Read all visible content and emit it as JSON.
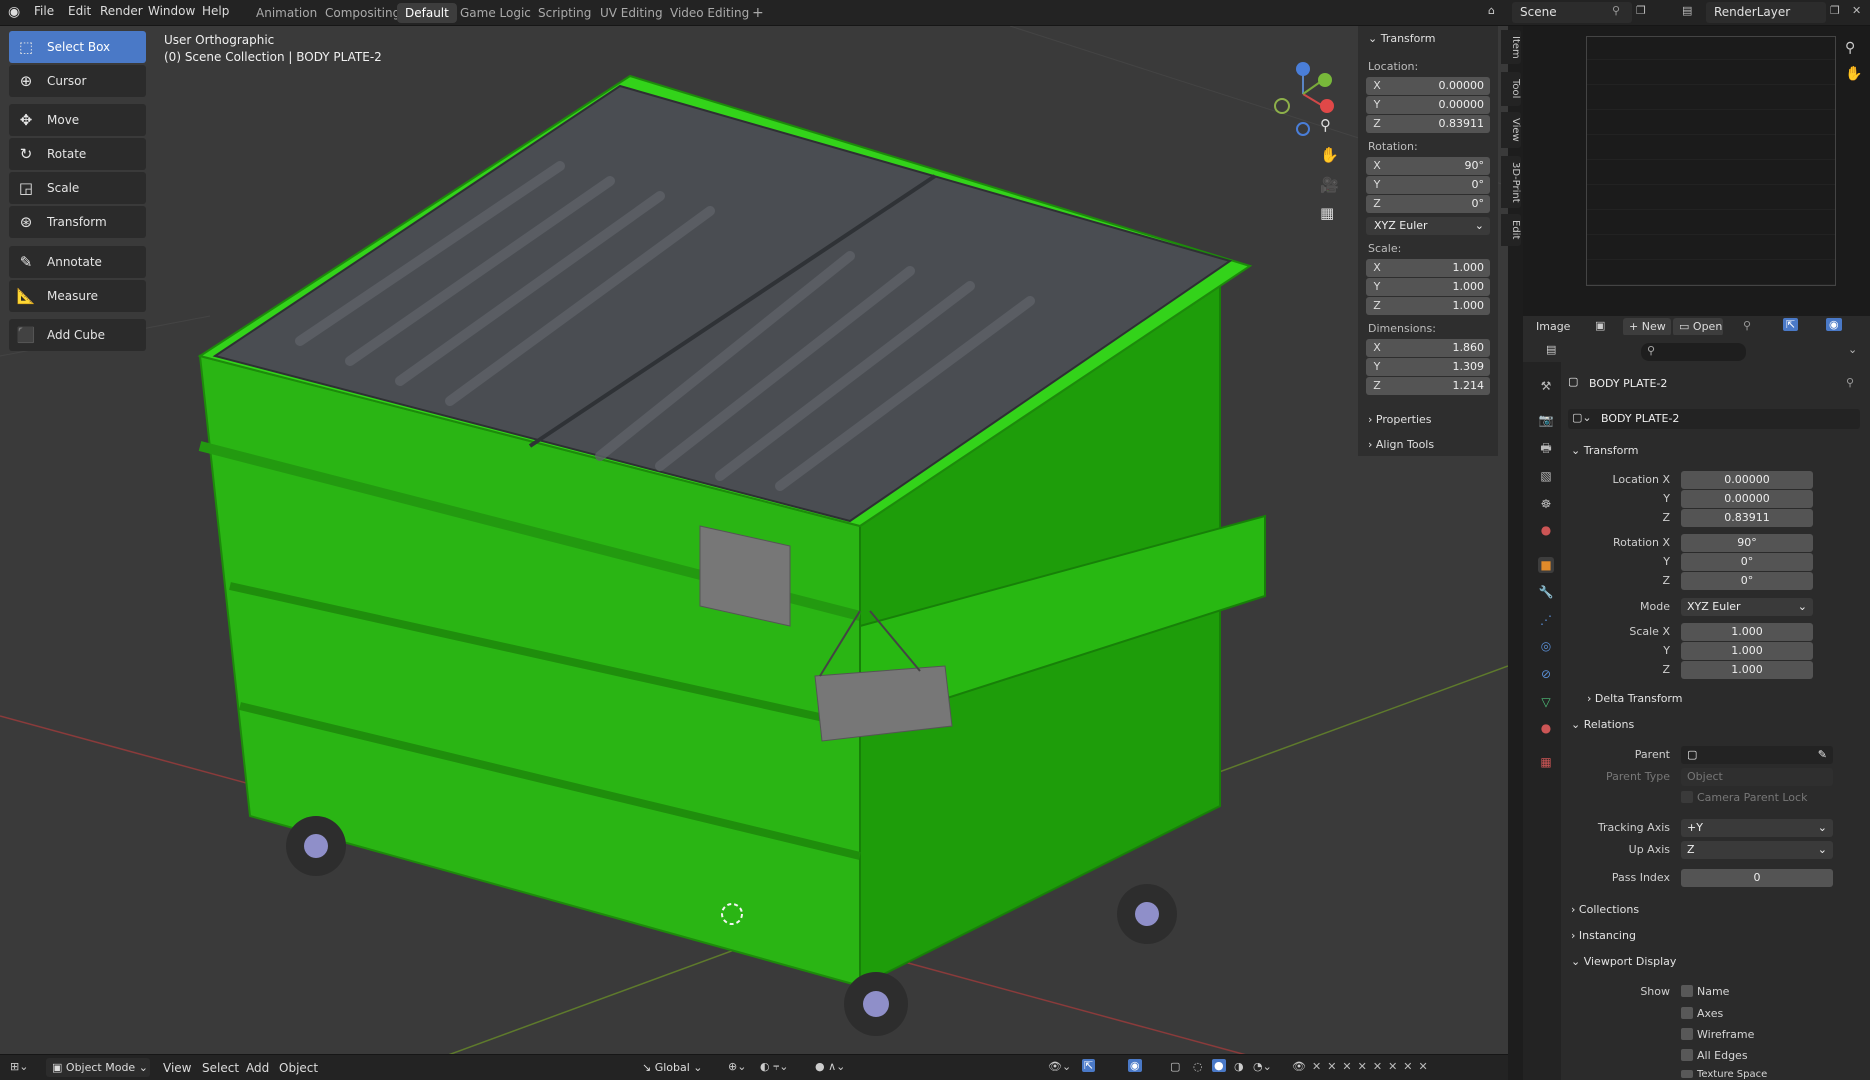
{
  "topbar": {
    "menus": [
      "File",
      "Edit",
      "Render",
      "Window",
      "Help"
    ],
    "workspaces": [
      "Animation",
      "Compositing",
      "Default",
      "Game Logic",
      "Scripting",
      "UV Editing",
      "Video Editing"
    ],
    "active_workspace": "Default",
    "add_workspace": "+",
    "scene": "Scene",
    "render_layer": "RenderLayer"
  },
  "toolbar": [
    "Select Box",
    "Cursor",
    "Move",
    "Rotate",
    "Scale",
    "Transform",
    "Annotate",
    "Measure",
    "Add Cube"
  ],
  "viewport": {
    "view_name": "User Orthographic",
    "collection_path": "(0) Scene Collection | BODY PLATE-2",
    "colors": {
      "object": "#2ecc16",
      "lid": "#4a4d52",
      "background": "#3a3a3a"
    }
  },
  "npanel": {
    "title": "Transform",
    "location_label": "Location:",
    "location": {
      "x": "0.00000",
      "y": "0.00000",
      "z": "0.83911"
    },
    "rotation_label": "Rotation:",
    "rotation": {
      "x": "90°",
      "y": "0°",
      "z": "0°"
    },
    "rotation_mode": "XYZ Euler",
    "scale_label": "Scale:",
    "scale": {
      "x": "1.000",
      "y": "1.000",
      "z": "1.000"
    },
    "dimensions_label": "Dimensions:",
    "dimensions": {
      "x": "1.860",
      "y": "1.309",
      "z": "1.214"
    },
    "properties": "Properties",
    "align_tools": "Align Tools",
    "tabs": [
      "Item",
      "Tool",
      "View",
      "3D-Print",
      "Edit"
    ],
    "axis_labels": {
      "x": "X",
      "y": "Y",
      "z": "Z"
    }
  },
  "image_editor": {
    "label": "Image",
    "new": "New",
    "open": "Open"
  },
  "properties": {
    "object_name": "BODY PLATE-2",
    "data_name": "BODY PLATE-2",
    "transform": "Transform",
    "location_x_label": "Location X",
    "location": [
      "0.00000",
      "0.00000",
      "0.83911"
    ],
    "rotation_x_label": "Rotation X",
    "rotation": [
      "90°",
      "0°",
      "0°"
    ],
    "mode_label": "Mode",
    "mode": "XYZ Euler",
    "scale_x_label": "Scale X",
    "scale": [
      "1.000",
      "1.000",
      "1.000"
    ],
    "y_label": "Y",
    "z_label": "Z",
    "delta_transform": "Delta Transform",
    "relations": "Relations",
    "parent_label": "Parent",
    "parent_type_label": "Parent Type",
    "parent_type": "Object",
    "camera_parent_lock": "Camera Parent Lock",
    "tracking_axis_label": "Tracking Axis",
    "tracking_axis": "+Y",
    "up_axis_label": "Up Axis",
    "up_axis": "Z",
    "pass_index_label": "Pass Index",
    "pass_index": "0",
    "collections": "Collections",
    "instancing": "Instancing",
    "viewport_display": "Viewport Display",
    "show_label": "Show",
    "show_items": [
      "Name",
      "Axes",
      "Wireframe",
      "All Edges",
      "Texture Space"
    ]
  },
  "bottombar": {
    "mode": "Object Mode",
    "view": "View",
    "select": "Select",
    "add": "Add",
    "object": "Object",
    "orientation": "Global"
  }
}
